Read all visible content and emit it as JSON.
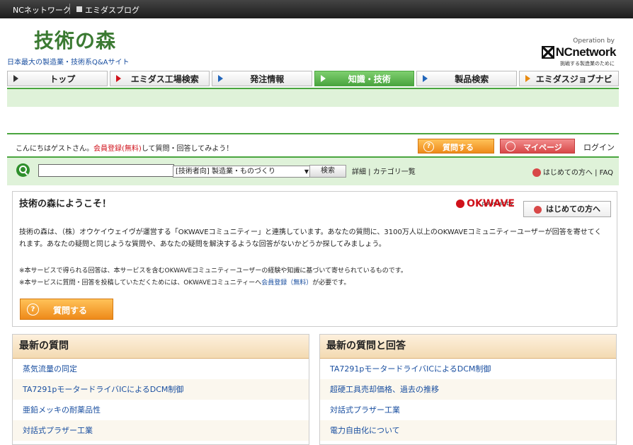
{
  "topbar": {
    "link1": "NCネットワーク",
    "link2": "エミダスブログ"
  },
  "header": {
    "logo_text": "技術の森",
    "tagline": "日本最大の製造業・技術系Q&Aサイト",
    "operation_by": "Operation by",
    "nc_logo": "NCnetwork",
    "nc_sub": "挑戦する製造業のために"
  },
  "nav": [
    {
      "label": "トップ"
    },
    {
      "label": "エミダス工場検索"
    },
    {
      "label": "発注情報"
    },
    {
      "label": "知識・技術"
    },
    {
      "label": "製品検索"
    },
    {
      "label": "エミダスジョブナビ"
    }
  ],
  "guest": {
    "before": "こんにちはゲストさん。",
    "link": "会員登録(無料)",
    "after": "して質問・回答してみよう！"
  },
  "actions": {
    "ask": "質問する",
    "mypage": "マイページ",
    "login": "ログイン"
  },
  "search": {
    "select_value": "[技術者向] 製造業・ものづくり",
    "button": "検索",
    "detail": "詳細",
    "category": "カテゴリ一覧",
    "first_visit": "はじめての方へ",
    "faq": "FAQ"
  },
  "welcome": {
    "title": "技術の森にようこそ！",
    "powered": "poweredby",
    "okwave": "OKWAVE",
    "first_btn": "はじめての方へ",
    "text": "技術の森は、（株）オウケイウェイヴが運営する「OKWAVEコミュニティー」と連携しています。あなたの質問に、3100万人以上のOKWAVEコミュニティーユーザーが回答を寄せてくれます。あなたの疑問と同じような質問や、あなたの疑問を解決するような回答がないかどうか探してみましょう。",
    "note1": "※本サービスで得られる回答は、本サービスを含むOKWAVEコミュニティーユーザーの経験や知識に基づいて寄せられているものです。",
    "note2_before": "※本サービスに質問・回答を投稿していただくためには、OKWAVEコミュニティーへ",
    "note2_link": "会員登録（無料）",
    "note2_after": "が必要です。",
    "ask_button": "質問する"
  },
  "latest_questions": {
    "title": "最新の質問",
    "items": [
      "蒸気流量の同定",
      "TA7291pモータードライバICによるDCM制御",
      "亜鉛メッキの耐薬品性",
      "対話式プラザー工業"
    ]
  },
  "latest_answers": {
    "title": "最新の質問と回答",
    "items": [
      "TA7291pモータードライバICによるDCM制御",
      "超硬工具売却価格、過去の推移",
      "対話式プラザー工業",
      "電力自由化について"
    ]
  }
}
